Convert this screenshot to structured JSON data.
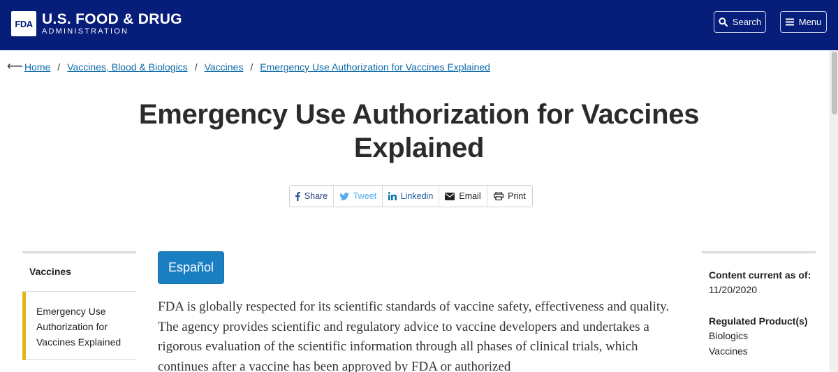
{
  "header": {
    "logo_mark": "FDA",
    "logo_line1": "U.S. FOOD & DRUG",
    "logo_line2": "ADMINISTRATION",
    "search_label": "Search",
    "menu_label": "Menu"
  },
  "breadcrumb": {
    "back_icon": "left-arrow-icon",
    "items": [
      "Home",
      "Vaccines, Blood & Biologics",
      "Vaccines",
      "Emergency Use Authorization for Vaccines Explained"
    ],
    "separator": "/"
  },
  "page_title": "Emergency Use Authorization for Vaccines Explained",
  "share_bar": {
    "share": "Share",
    "tweet": "Tweet",
    "linkedin": "Linkedin",
    "email": "Email",
    "print": "Print"
  },
  "left_nav": {
    "heading": "Vaccines",
    "active_item": "Emergency Use Authorization for Vaccines Explained"
  },
  "espanol_label": "Español",
  "body_paragraph": "FDA is globally respected for its scientific standards of vaccine safety, effectiveness and quality. The agency provides scientific and regulatory advice to vaccine developers and undertakes a rigorous evaluation of the scientific information through all phases of clinical trials, which continues after a vaccine has been approved by FDA or authorized",
  "right_sidebar": {
    "content_current_label": "Content current as of:",
    "content_current_date": "11/20/2020",
    "regulated_label": "Regulated Product(s)",
    "regulated_items": [
      "Biologics",
      "Vaccines"
    ]
  },
  "colors": {
    "header_bg": "#071d7a",
    "link": "#0b6aa8",
    "espanol_bg": "#1a7fc1",
    "nav_accent": "#e1b61a"
  }
}
